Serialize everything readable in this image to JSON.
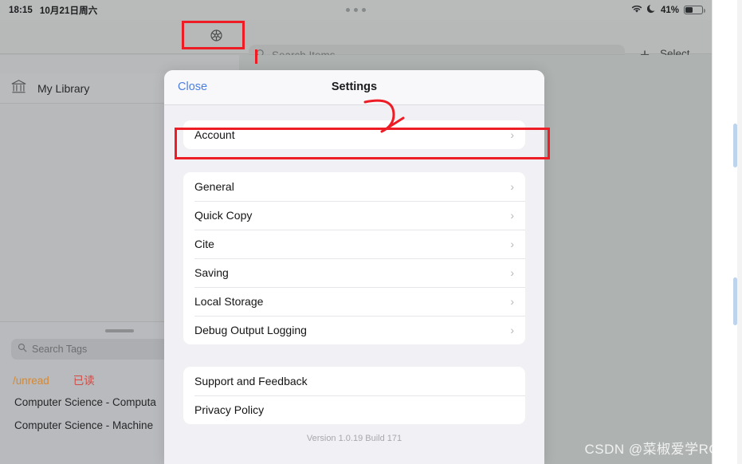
{
  "status_bar": {
    "time": "18:15",
    "date": "10月21日周六",
    "wifi_icon": "wifi-icon",
    "moon_icon": "moon-icon",
    "battery_percent": "41%",
    "battery_level": 41,
    "multitask_handle": "multitask-dots"
  },
  "toolbar": {
    "gear_icon": "gear-icon",
    "search_icon": "search-icon",
    "search_placeholder": "Search Items",
    "search_value": "",
    "add_label": "+",
    "select_label": "Select"
  },
  "sidebar": {
    "library": {
      "icon": "library-bank-icon",
      "label": "My Library"
    },
    "tags": {
      "grabber": "drag-handle",
      "search_icon": "search-icon",
      "search_placeholder": "Search Tags",
      "search_value": "",
      "chips": [
        {
          "label": "/unread",
          "color": "#e08a2c"
        },
        {
          "label": "已读",
          "color": "#e0413c"
        }
      ],
      "items": [
        "Computer Science - Computa",
        "Computer Science - Machine "
      ]
    }
  },
  "modal": {
    "close_label": "Close",
    "title": "Settings",
    "groups": [
      {
        "id": "account",
        "rows": [
          {
            "label": "Account",
            "chevron": "chevron-right-icon"
          }
        ]
      },
      {
        "id": "main",
        "rows": [
          {
            "label": "General",
            "chevron": "chevron-right-icon"
          },
          {
            "label": "Quick Copy",
            "chevron": "chevron-right-icon"
          },
          {
            "label": "Cite",
            "chevron": "chevron-right-icon"
          },
          {
            "label": "Saving",
            "chevron": "chevron-right-icon"
          },
          {
            "label": "Local Storage",
            "chevron": "chevron-right-icon"
          },
          {
            "label": "Debug Output Logging",
            "chevron": "chevron-right-icon"
          }
        ]
      },
      {
        "id": "support",
        "rows": [
          {
            "label": "Support and Feedback",
            "chevron": ""
          },
          {
            "label": "Privacy Policy",
            "chevron": ""
          }
        ]
      }
    ],
    "version": "Version 1.0.19 Build 171"
  },
  "annotations": {
    "color": "#ee1c25",
    "gear_highlight": "red-rectangle-around-gear",
    "account_highlight": "red-rectangle-around-account",
    "arrow": "red-curved-arrow-to-account"
  },
  "watermark": {
    "text": "CSDN @菜椒爱学ROS"
  },
  "colors": {
    "accent_blue": "#4c7fe0",
    "annotation_red": "#ee1c25",
    "sidebar_gray": "#c0c1c5",
    "chrome_gray": "#b6b9b8",
    "modal_bg": "#f1f1f5"
  }
}
